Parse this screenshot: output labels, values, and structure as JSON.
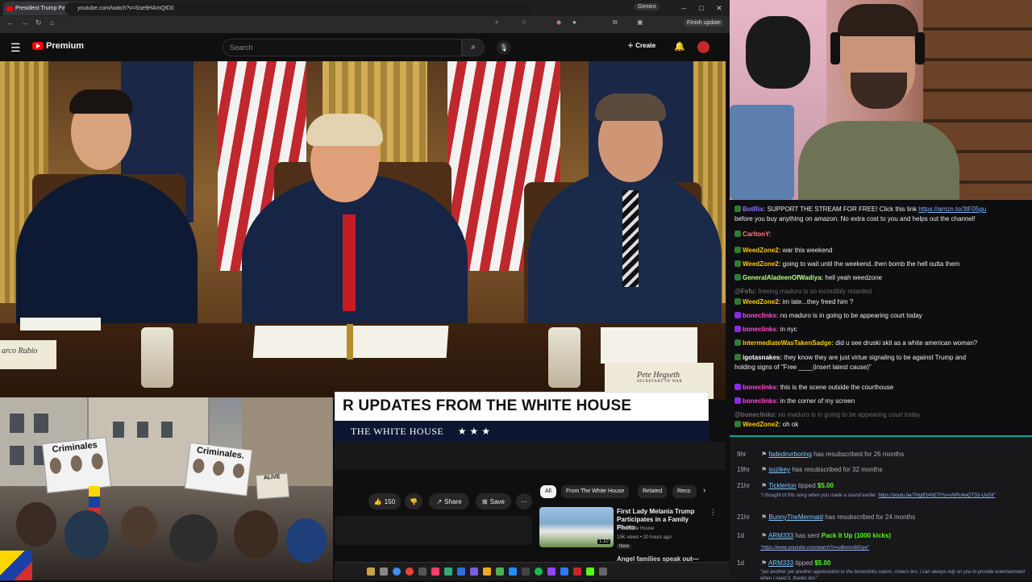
{
  "browser": {
    "tab_title": "President Trump Participat",
    "extension_label": "Gemini",
    "url": "youtube.com/watch?v=Sse9HAmQtD0",
    "update_label": "Finish update"
  },
  "youtube": {
    "logo_text": "Premium",
    "search_placeholder": "Search",
    "create_label": "Create",
    "like_count": "150",
    "share_label": "Share",
    "save_label": "Save",
    "chips": [
      "All",
      "From The White House",
      "Related",
      "Reco"
    ],
    "recommendation": {
      "title": "First Lady Melania Trump Participates in a Family Photo",
      "channel": "The White House",
      "meta": "15K views • 20 hours ago",
      "badge": "New",
      "duration": "1:10",
      "next_title": "Angel families speak out—"
    }
  },
  "video": {
    "banner_title": "R UPDATES FROM THE WHITE HOUSE",
    "banner_sub": "THE WHITE HOUSE",
    "banner_stars": "★ ★ ★",
    "placard_left": "arco Rubio",
    "placard_right": "Pete Hegseth",
    "placard_right_sub": "SECRETARY OF WAR"
  },
  "protest": {
    "sign_text": "Criminales",
    "sign_text_2": "Criminales.",
    "sign_text_3": "ALIVE"
  },
  "chat": [
    {
      "user": "BotRix",
      "color": "#8e74ff",
      "text": "SUPPORT THE STREAM FOR FREE! Click this link",
      "link": "https://amzn.to/3tF05gu",
      "text2": "before you buy anything on amazon. No extra cost to you and helps out the channel!"
    },
    {
      "user": "CarltonY",
      "color": "#ff7f7f",
      "text": ""
    },
    {
      "user": "WeedZone2",
      "color": "#ffcc00",
      "text": "war this weekend"
    },
    {
      "user": "WeedZone2",
      "color": "#ffcc00",
      "text": "going to wait until the weekend..then bomb the hell outta them"
    },
    {
      "user": "GeneralAladeenOfWadiya",
      "color": "#b7ff7f",
      "text": "hell yeah weedzone"
    },
    {
      "user": "@Fefu",
      "color": "#6b6b6b",
      "text": "freeing maduro is so incredibly retarded",
      "dim": true
    },
    {
      "user": "WeedZone2",
      "color": "#ffcc00",
      "text": "im late...they freed him ?"
    },
    {
      "user": "boneclinks",
      "color": "#ff4fd8",
      "text": "no maduro is in going to be appearing court today"
    },
    {
      "user": "boneclinks",
      "color": "#ff4fd8",
      "text": "in nyc"
    },
    {
      "user": "IntermediateWasTakenSadge",
      "color": "#ffcc00",
      "text": "did u see druski skit as a white american woman?"
    },
    {
      "user": "igotasnakes",
      "color": "#ffffff",
      "text": "they know they are just virtue signaling to be against Trump and",
      "text2": "holding signs of \"Free ____(insert latest cause)\""
    },
    {
      "user": "boneclinks",
      "color": "#ff4fd8",
      "text": "this is the scene outside the courthouse"
    },
    {
      "user": "boneclinks",
      "color": "#ff4fd8",
      "text": "in the corner of my screen"
    },
    {
      "user": "@boneclinks",
      "color": "#6b6b6b",
      "text": "no maduro is in going to be appearing court today",
      "dim": true
    },
    {
      "user": "WeedZone2",
      "color": "#ffcc00",
      "text": "oh ok"
    }
  ],
  "events": [
    {
      "time": "9hr",
      "name": "fadednvrboring",
      "text": "has resubscribed for 26 months"
    },
    {
      "time": "19hr",
      "name": "suzikey",
      "text": "has resubscribed for 32 months"
    },
    {
      "time": "21hr",
      "name": "Ticklerton",
      "text": "tipped",
      "amount": "$5.00",
      "sub": "\"I thought of this song when you made a sound earlier.",
      "sub_link": "https://youtu.be/7HgIEtAhE7I?si=vNPc4wQTSb-UnDil\""
    },
    {
      "time": "21hr",
      "name": "BunnyTheMermaid",
      "text": "has resubscribed for 24 months"
    },
    {
      "time": "1d",
      "name": "ARM333",
      "text": "has sent",
      "amount": "Pack It Up (1000 kicks)",
      "sub_link": "\"https://www.youtube.com/watch?v=u8mmn9lOiye\""
    },
    {
      "time": "1d",
      "name": "ARM333",
      "text": "tipped",
      "amount": "$5.00",
      "sub": "\"yet another yet another appreciation to the boneclinks nation, cheers bro, i can always rely on you to provide entertainment when i need it, thanks bro\""
    }
  ],
  "colors": {
    "youtube_red": "#ff0000",
    "kick_green": "#53fc18",
    "events_accent": "#00ad96"
  }
}
